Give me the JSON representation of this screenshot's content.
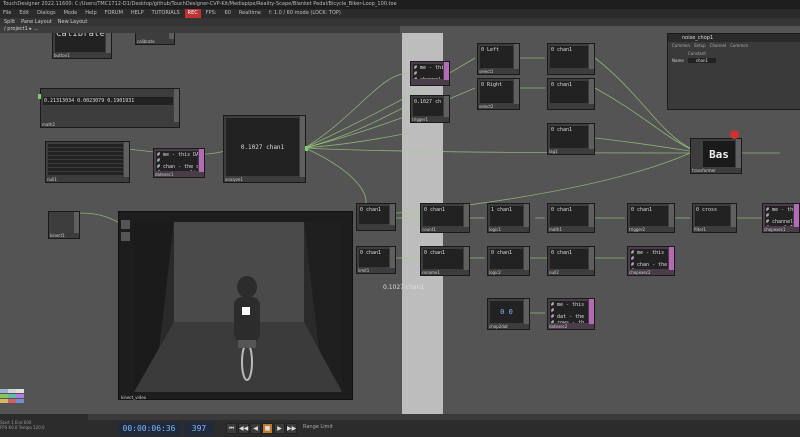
{
  "window": {
    "title": "TouchDesigner 2022.11600: C:/Users/TMC1712-D1/Desktop/github/TouchDesigner-CVP-Kit/Mediapipe/Reality-Scape/Blanket Pedal/Bicycle_Biker-Loop_100.toe"
  },
  "menu": [
    "File",
    "Edit",
    "Dialogs",
    "Mode",
    "Help",
    "FORUM",
    "HELP",
    "TUTORIALS",
    "REC",
    "FPS:",
    "60",
    "Realtime",
    "f: 1.0 / 60 mode (LOCK: TOP)"
  ],
  "pane": {
    "split_label": "Split",
    "layout_label": "Pane Layout",
    "new_layout_label": "New Layout"
  },
  "path": "/ project1 ▸ ...",
  "param": {
    "title": "noise_chop1",
    "tabs": [
      "Common",
      "Setup",
      "Channel",
      "Common"
    ],
    "row1_label": "Constant",
    "row2_label": "Name",
    "row2_value": "chan1"
  },
  "nodes": {
    "calibrate": "Calibrate",
    "calibrate_label": "button1",
    "calibrate2": "calibrate",
    "numbers_text": "0.21313034  0.0023079  0.1901931",
    "numbers_label": "math2",
    "top_left_label": "null1",
    "dat1_text": "# me - this DAT\n#\n# chan - the chan\n# rows - a list",
    "dat1_label": "datexec1",
    "value_big": "0.1027 chan1",
    "value_big_label": "analyze1",
    "value_small1": "0.1027 ch",
    "value_small1_label": "trigger1",
    "left_text": "0 Left",
    "right_text": "0 Right",
    "left2": "0 chan1",
    "right2": "0 chan1",
    "left_label": "select1",
    "right_label": "select2",
    "lag_text": "0 chan1",
    "lag_label": "lag1",
    "bas_text": "Bas",
    "bas_label": "transformer",
    "kin": "kinect1",
    "video_label": "kinect_video",
    "math_text": "0 chan1",
    "switch_text": "1 chan1",
    "switch_label": "logic1",
    "null_text": "0 chan1",
    "null_label": "math1",
    "events_label": "0 chan1",
    "events_lbl": "trigger2",
    "count_label": "0 chan1",
    "count_lbl": "count1",
    "last_label": "0 cross",
    "last_lbl": "filter1",
    "script_text": "# me - this\n#\n# channel\n# sampleIn",
    "script_lbl": "chopexec1",
    "r2a": "0 chan1",
    "r2b": "0 chan1",
    "r2c": "0 chan1",
    "r2d": "0 chan1",
    "r2e": "0 chan1",
    "r2_labels": [
      "rename1",
      "logic2",
      "null2",
      "math3",
      "speed1"
    ],
    "script2_text": "# me - this\n#\n# chan - the\n# rows - a",
    "script2_lbl": "chopexec2",
    "datnode3_lbl": "chop2dat",
    "datnode4_lbl": "datexec2",
    "mid_value": "0.1027 chan1",
    "limit_label": "0 chan1",
    "limit_lbl": "limit1",
    "cube_text": "0 chan1",
    "cube_lbl": "trail1",
    "dat3_text": "0 0",
    "dat4_text": "# me - this\n#\n# dat - the\n# rows - th"
  },
  "bottom": {
    "timecode": "00:00:06:36",
    "frame": "397",
    "range_label": "Range Limit",
    "info": [
      "Start",
      "End",
      "RStart",
      "REnd",
      "FPS",
      "Tempo",
      "TSig"
    ],
    "info_vals": [
      "1",
      "600",
      "1",
      "600",
      "60.0",
      "120.0",
      "4  4"
    ],
    "controls": [
      "⏮",
      "◀◀",
      "◀",
      "■",
      "▶",
      "▶▶",
      "⏭"
    ]
  },
  "colors": {
    "accent_green": "#7dcf6e",
    "dat_purple": "#b46ab4",
    "column_gray": "#bdbdbd",
    "error_red": "#d13030"
  }
}
